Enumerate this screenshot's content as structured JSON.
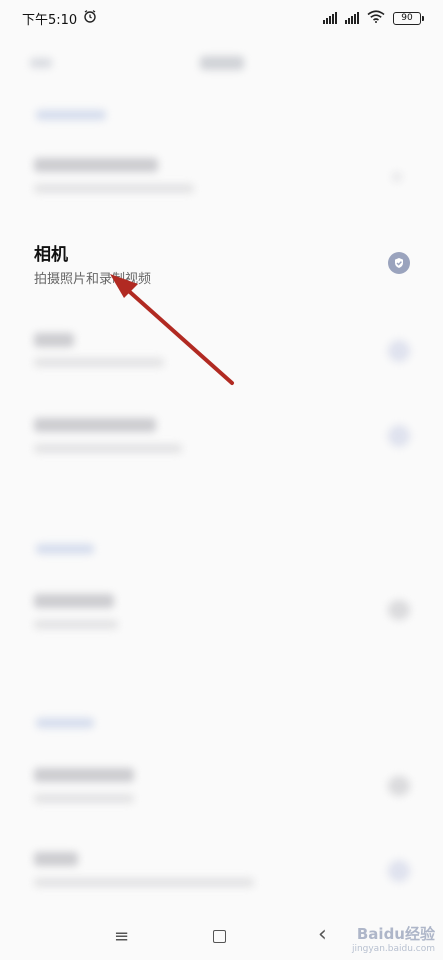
{
  "status_bar": {
    "time": "下午5:10",
    "battery": "90"
  },
  "camera_item": {
    "title": "相机",
    "subtitle": "拍摄照片和录制视频"
  },
  "watermark": {
    "brand": "Baidu经验",
    "domain": "jingyan.baidu.com"
  },
  "colors": {
    "background": "#fafafa",
    "arrow": "#b12a22",
    "check_badge": "#9aa3bd"
  }
}
